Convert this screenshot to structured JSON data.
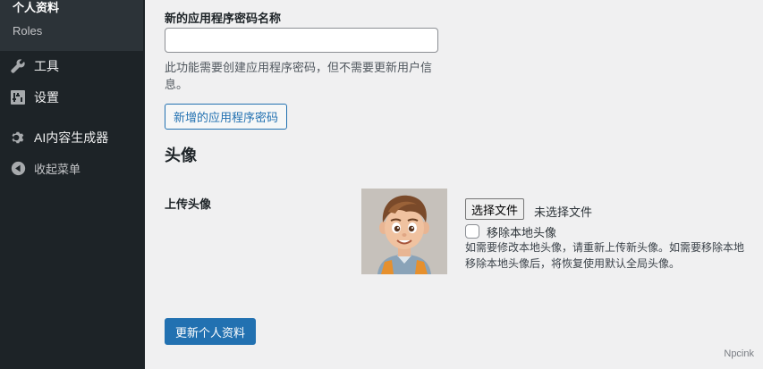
{
  "sidebar": {
    "submenu": {
      "current": "个人资料",
      "roles": "Roles"
    },
    "items": [
      {
        "label": "工具",
        "icon": "wrench-icon"
      },
      {
        "label": "设置",
        "icon": "settings-sliders-icon"
      },
      {
        "label": "AI内容生成器",
        "icon": "gear-icon"
      },
      {
        "label": "收起菜单",
        "icon": "collapse-arrow-icon"
      }
    ]
  },
  "app_password": {
    "label": "新的应用程序密码名称",
    "value": "",
    "help": "此功能需要创建应用程序密码，但不需要更新用户信息。",
    "add_button": "新增的应用程序密码"
  },
  "avatar_section": {
    "title": "头像",
    "upload_label": "上传头像",
    "choose_file_button": "选择文件",
    "no_file_text": "未选择文件",
    "remove_local_label": "移除本地头像",
    "remove_local_checked": false,
    "description_line1": "如需要修改本地头像，请重新上传新头像。如需要移除本地",
    "description_line2": "移除本地头像后，将恢复使用默认全局头像。"
  },
  "submit_button": "更新个人资料",
  "watermark": "Npcink",
  "colors": {
    "sidebar": "#1d2327",
    "accent": "#2271b1",
    "background": "#f0f0f1"
  }
}
